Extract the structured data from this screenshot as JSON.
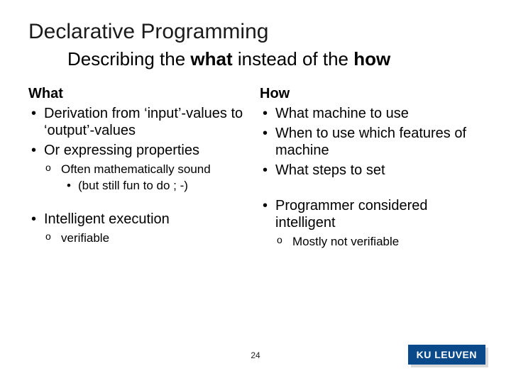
{
  "title": "Declarative Programming",
  "subtitle": {
    "pre": "Describing the ",
    "b1": "what",
    "mid": " instead of the ",
    "b2": "how"
  },
  "left": {
    "head": "What",
    "b1": "Derivation from ‘input’-values to ‘output’-values",
    "b2": "Or expressing properties",
    "s1": "Often mathematically sound",
    "ss1": "(but still fun to do ; -)",
    "b3": "Intelligent execution",
    "s2": "verifiable"
  },
  "right": {
    "head": "How",
    "b1": "What machine to use",
    "b2": "When to use which features of machine",
    "b3": "What steps to set",
    "b4": "Programmer considered intelligent",
    "s1": "Mostly not verifiable"
  },
  "pageNum": "24",
  "logo": "KU LEUVEN"
}
